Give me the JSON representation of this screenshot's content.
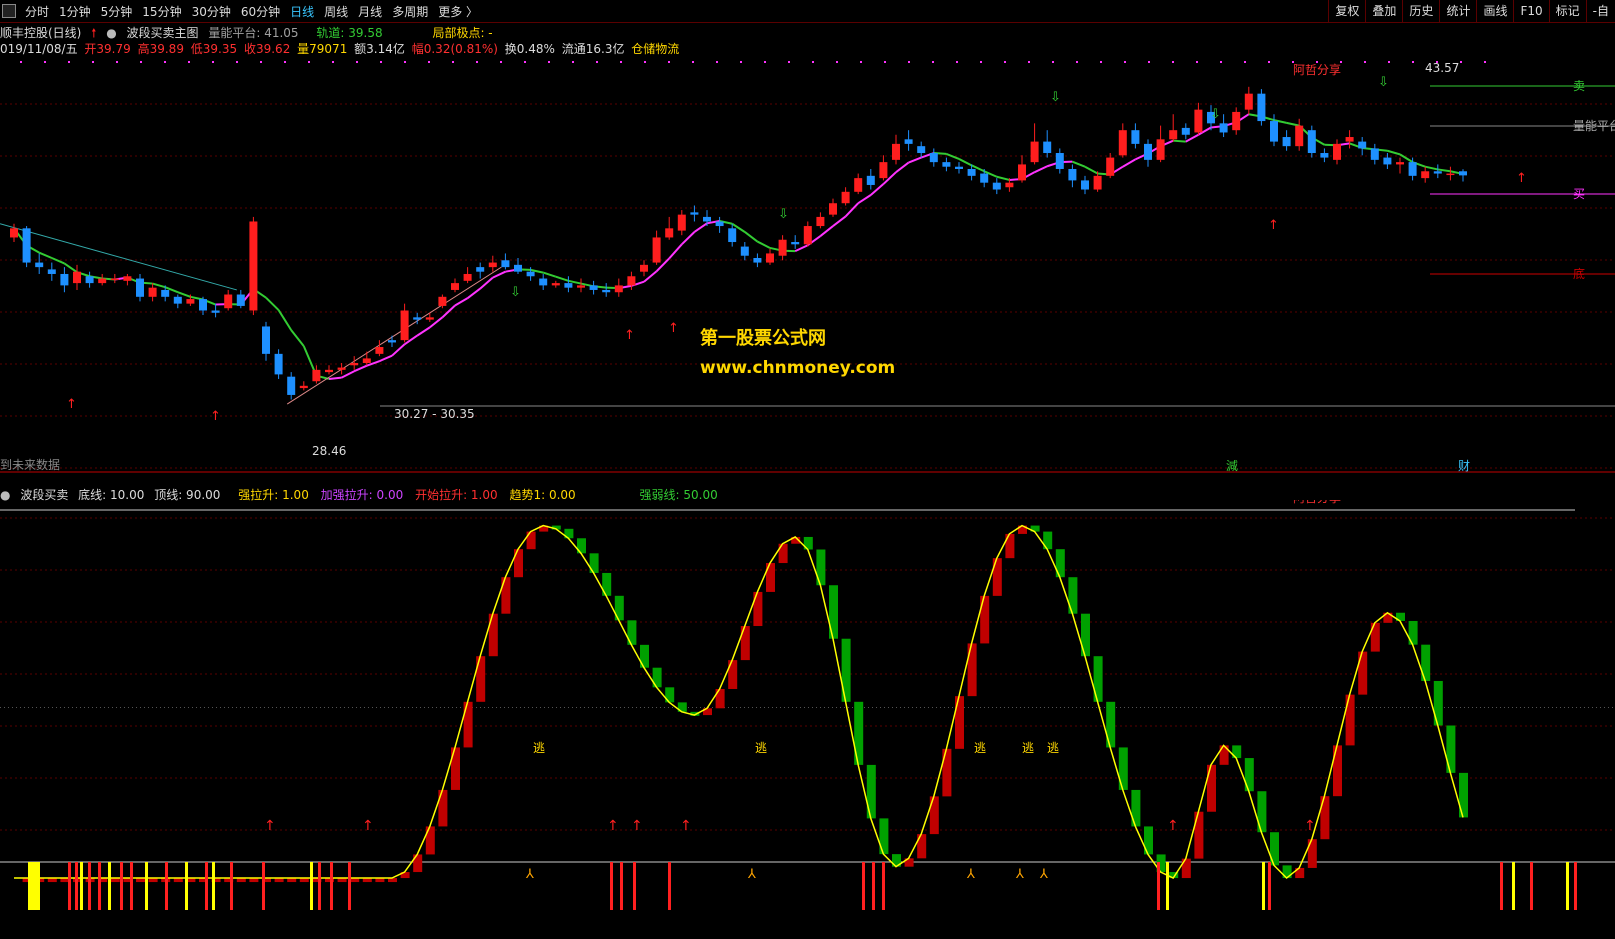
{
  "toolbar": {
    "items": [
      "分时",
      "1分钟",
      "5分钟",
      "15分钟",
      "30分钟",
      "60分钟",
      "日线",
      "周线",
      "月线",
      "多周期",
      "更多 〉"
    ],
    "active_index": 6,
    "right_buttons": [
      "复权",
      "叠加",
      "历史",
      "统计",
      "画线",
      "F10",
      "标记",
      "-自"
    ]
  },
  "header": {
    "stock_name": "顺丰控股(日线)",
    "indicator_name": "波段买卖主图",
    "platform_label": "量能平台: 41.05",
    "track_label": "轨道: 39.58",
    "local_extreme": "局部极点: -",
    "date": "019/11/08/五",
    "open": "开39.79",
    "high": "高39.89",
    "low": "低39.35",
    "close": "收39.62",
    "volume": "量79071",
    "amount": "额3.14亿",
    "change": "幅0.32(0.81%)",
    "turnover": "换0.48%",
    "float_cap": "流通16.3亿",
    "sector": "仓储物流"
  },
  "main_labels": {
    "price_high": "43.57",
    "price_low": "28.46",
    "range_label": "30.27 - 30.35",
    "share_label": "阿哲分享",
    "sell_label": "卖",
    "platform_line": "量能平台",
    "buy_label": "买",
    "support_label": "底",
    "future_note": "到未来数据",
    "jian": "減",
    "cai": "财"
  },
  "watermark": {
    "title": "第一股票公式网",
    "url": "www.chnmoney.com"
  },
  "oscillator": {
    "name": "波段买卖",
    "bottom": "底线: 10.00",
    "top": "顶线: 90.00",
    "strong": "强拉升: 1.00",
    "strong_add": "加强拉升: 0.00",
    "start": "开始拉升: 1.00",
    "trend": "趋势1: 0.00",
    "strong_weak": "强弱线: 50.00",
    "share_label": "阿哲分享",
    "escape_label": "逃"
  },
  "colors": {
    "up": "#ff1e1e",
    "down": "#1e90ff",
    "ma_green": "#33cc33",
    "ma_magenta": "#ff33ff",
    "osc_up": "#c00000",
    "osc_down": "#00a000",
    "yellow": "#ffff00"
  },
  "chart_data": {
    "type": "candlestick",
    "candles": [
      [
        36.9,
        37.3,
        37.5,
        36.7
      ],
      [
        37.3,
        35.8,
        37.4,
        35.6
      ],
      [
        35.8,
        35.6,
        36.2,
        35.3
      ],
      [
        35.5,
        35.3,
        35.8,
        35.0
      ],
      [
        35.3,
        34.8,
        35.6,
        34.5
      ],
      [
        34.9,
        35.4,
        35.7,
        34.6
      ],
      [
        35.2,
        34.9,
        35.4,
        34.7
      ],
      [
        34.9,
        35.1,
        35.3,
        34.8
      ],
      [
        35.1,
        35.1,
        35.3,
        34.9
      ],
      [
        35.0,
        35.2,
        35.3,
        34.8
      ],
      [
        35.1,
        34.3,
        35.3,
        34.1
      ],
      [
        34.3,
        34.7,
        34.9,
        34.1
      ],
      [
        34.6,
        34.3,
        34.8,
        34.1
      ],
      [
        34.3,
        34.0,
        34.4,
        33.8
      ],
      [
        34.0,
        34.2,
        34.4,
        33.9
      ],
      [
        34.2,
        33.7,
        34.3,
        33.5
      ],
      [
        33.7,
        33.6,
        34.0,
        33.4
      ],
      [
        33.8,
        34.4,
        34.6,
        33.7
      ],
      [
        34.4,
        33.9,
        34.6,
        33.8
      ],
      [
        33.7,
        37.6,
        37.8,
        33.5
      ],
      [
        33.0,
        31.8,
        33.2,
        31.5
      ],
      [
        31.8,
        30.9,
        32.0,
        30.7
      ],
      [
        30.8,
        30.0,
        31.0,
        29.8
      ],
      [
        30.3,
        30.4,
        30.6,
        30.2
      ],
      [
        30.6,
        31.1,
        31.3,
        30.5
      ],
      [
        31.0,
        31.1,
        31.3,
        30.9
      ],
      [
        31.1,
        31.2,
        31.4,
        30.9
      ],
      [
        31.3,
        31.4,
        31.7,
        31.1
      ],
      [
        31.4,
        31.6,
        31.9,
        31.3
      ],
      [
        31.8,
        32.1,
        32.4,
        31.7
      ],
      [
        32.4,
        32.3,
        32.6,
        32.1
      ],
      [
        32.4,
        33.7,
        34.0,
        32.3
      ],
      [
        33.4,
        33.3,
        33.6,
        33.1
      ],
      [
        33.3,
        33.4,
        33.6,
        33.2
      ],
      [
        33.9,
        34.3,
        34.4,
        33.8
      ],
      [
        34.6,
        34.9,
        35.1,
        34.5
      ],
      [
        35.0,
        35.3,
        35.6,
        34.9
      ],
      [
        35.6,
        35.4,
        35.8,
        35.1
      ],
      [
        35.6,
        35.8,
        36.1,
        35.4
      ],
      [
        35.9,
        35.6,
        36.2,
        35.5
      ],
      [
        35.7,
        35.4,
        36.0,
        35.3
      ],
      [
        35.4,
        35.2,
        35.6,
        35.0
      ],
      [
        35.1,
        34.8,
        35.3,
        34.6
      ],
      [
        34.8,
        34.9,
        35.0,
        34.7
      ],
      [
        34.9,
        34.7,
        35.2,
        34.5
      ],
      [
        34.7,
        34.8,
        35.1,
        34.5
      ],
      [
        34.8,
        34.6,
        35.0,
        34.4
      ],
      [
        34.6,
        34.5,
        34.9,
        34.3
      ],
      [
        34.5,
        34.8,
        35.1,
        34.3
      ],
      [
        34.8,
        35.2,
        35.4,
        34.6
      ],
      [
        35.4,
        35.7,
        35.9,
        35.2
      ],
      [
        35.8,
        36.9,
        37.2,
        35.7
      ],
      [
        36.9,
        37.3,
        37.8,
        36.8
      ],
      [
        37.2,
        37.9,
        38.1,
        37.0
      ],
      [
        38.0,
        37.9,
        38.3,
        37.6
      ],
      [
        37.8,
        37.6,
        38.1,
        37.4
      ],
      [
        37.6,
        37.4,
        37.8,
        37.1
      ],
      [
        37.3,
        36.7,
        37.5,
        36.5
      ],
      [
        36.5,
        36.1,
        36.7,
        35.9
      ],
      [
        36.0,
        35.8,
        36.2,
        35.6
      ],
      [
        35.8,
        36.2,
        36.4,
        35.7
      ],
      [
        36.1,
        36.8,
        37.0,
        35.9
      ],
      [
        36.7,
        36.6,
        37.0,
        36.4
      ],
      [
        36.6,
        37.4,
        37.6,
        36.5
      ],
      [
        37.4,
        37.8,
        38.0,
        37.3
      ],
      [
        37.9,
        38.4,
        38.6,
        37.8
      ],
      [
        38.4,
        38.9,
        39.1,
        38.3
      ],
      [
        38.9,
        39.5,
        39.7,
        38.8
      ],
      [
        39.6,
        39.2,
        39.9,
        39.0
      ],
      [
        39.5,
        40.2,
        40.5,
        39.4
      ],
      [
        40.3,
        41.0,
        41.4,
        40.1
      ],
      [
        41.2,
        41.0,
        41.6,
        40.7
      ],
      [
        40.9,
        40.6,
        41.1,
        40.4
      ],
      [
        40.6,
        40.2,
        40.8,
        40.0
      ],
      [
        40.2,
        40.0,
        40.4,
        39.8
      ],
      [
        40.0,
        39.9,
        40.2,
        39.7
      ],
      [
        39.9,
        39.6,
        40.1,
        39.4
      ],
      [
        39.7,
        39.3,
        39.9,
        39.1
      ],
      [
        39.3,
        39.0,
        39.5,
        38.8
      ],
      [
        39.1,
        39.3,
        39.5,
        38.9
      ],
      [
        39.4,
        40.1,
        40.5,
        39.3
      ],
      [
        40.2,
        41.1,
        41.9,
        40.1
      ],
      [
        41.1,
        40.6,
        41.6,
        40.4
      ],
      [
        40.6,
        39.9,
        40.8,
        39.7
      ],
      [
        39.9,
        39.4,
        40.1,
        39.1
      ],
      [
        39.4,
        39.0,
        39.6,
        38.8
      ],
      [
        39.0,
        39.6,
        39.8,
        38.9
      ],
      [
        39.6,
        40.4,
        40.6,
        39.5
      ],
      [
        40.5,
        41.6,
        41.9,
        40.4
      ],
      [
        41.6,
        41.0,
        41.9,
        40.8
      ],
      [
        41.0,
        40.3,
        41.2,
        40.0
      ],
      [
        40.3,
        41.2,
        41.8,
        40.2
      ],
      [
        41.2,
        41.6,
        42.3,
        41.1
      ],
      [
        41.7,
        41.4,
        41.9,
        41.2
      ],
      [
        41.5,
        42.5,
        42.8,
        41.4
      ],
      [
        42.4,
        41.9,
        42.7,
        41.6
      ],
      [
        41.9,
        41.5,
        42.3,
        41.3
      ],
      [
        41.6,
        42.4,
        42.6,
        41.4
      ],
      [
        42.5,
        43.2,
        43.5,
        42.3
      ],
      [
        43.2,
        42.0,
        43.4,
        41.8
      ],
      [
        42.0,
        41.1,
        42.3,
        40.9
      ],
      [
        41.3,
        40.9,
        41.6,
        40.7
      ],
      [
        40.9,
        41.8,
        42.1,
        40.7
      ],
      [
        41.6,
        40.6,
        41.8,
        40.4
      ],
      [
        40.6,
        40.4,
        40.8,
        40.2
      ],
      [
        40.3,
        41.0,
        41.2,
        40.1
      ],
      [
        41.1,
        41.3,
        41.6,
        40.8
      ],
      [
        41.1,
        40.8,
        41.3,
        40.5
      ],
      [
        40.8,
        40.3,
        41.0,
        40.1
      ],
      [
        40.4,
        40.1,
        40.6,
        39.9
      ],
      [
        40.1,
        40.2,
        40.4,
        39.7
      ],
      [
        40.2,
        39.6,
        40.4,
        39.4
      ],
      [
        39.5,
        39.8,
        40.0,
        39.3
      ],
      [
        39.8,
        39.7,
        40.1,
        39.5
      ],
      [
        39.7,
        39.7,
        40.0,
        39.4
      ],
      [
        39.8,
        39.62,
        39.89,
        39.35
      ]
    ]
  }
}
